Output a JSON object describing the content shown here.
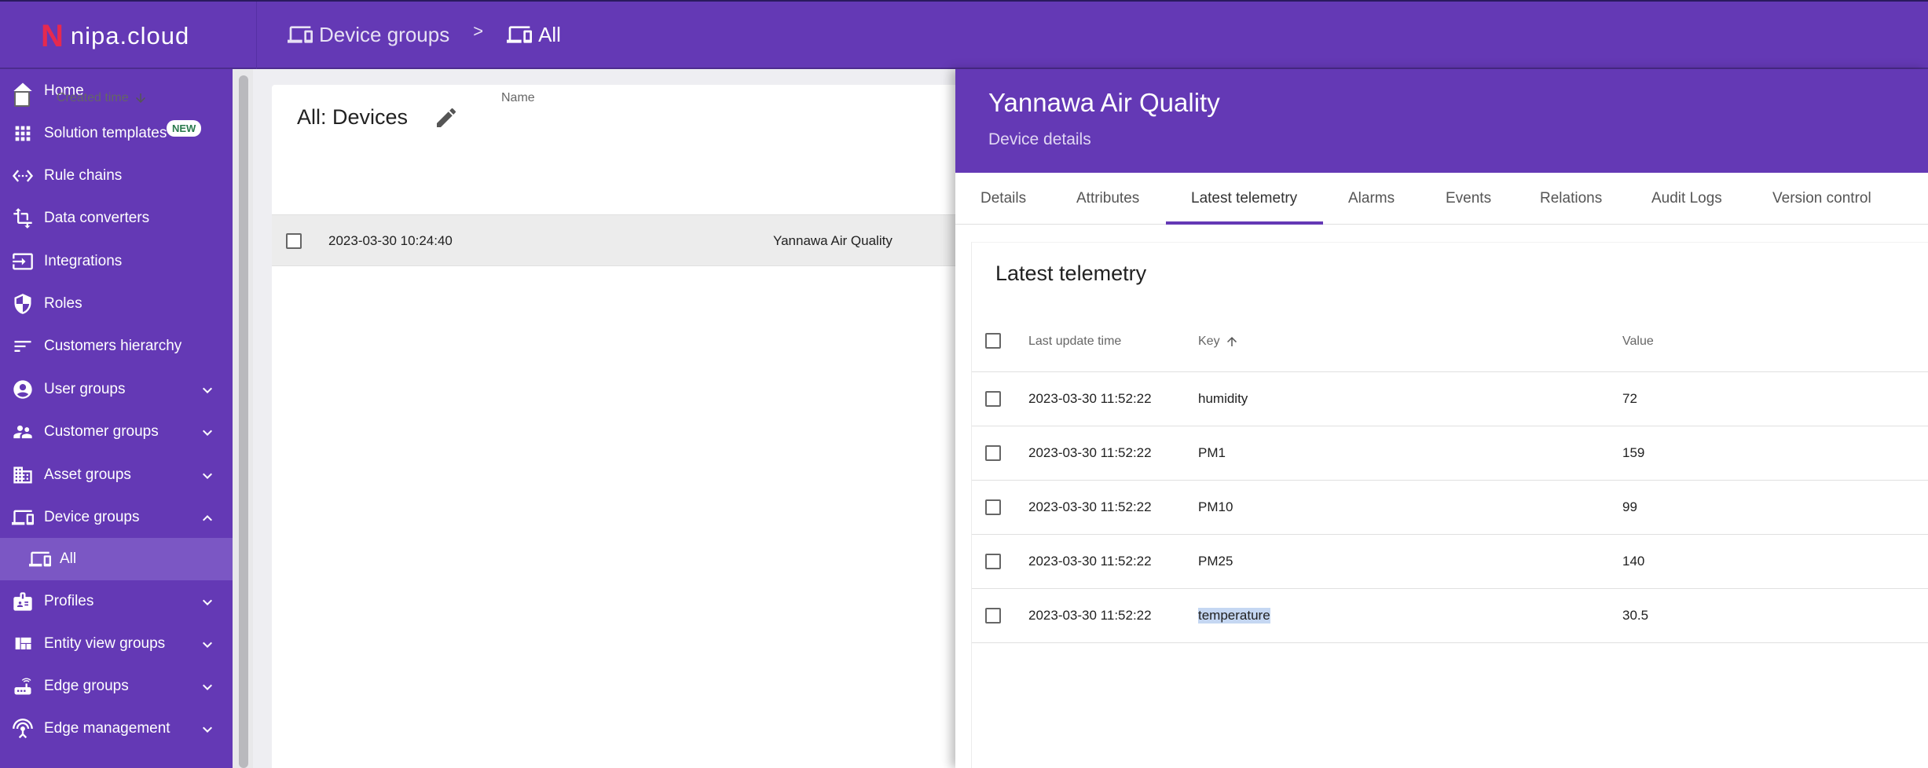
{
  "app": {
    "logo_text": "nipa.cloud",
    "logo_mark": "N"
  },
  "breadcrumb": [
    {
      "label": "Device groups",
      "icon": "devices-icon"
    },
    {
      "label": "All",
      "icon": "devices-icon"
    }
  ],
  "breadcrumb_separator": ">",
  "sidebar": {
    "items": [
      {
        "label": "Home",
        "icon": "home-icon"
      },
      {
        "label": "Solution templates",
        "icon": "apps-icon",
        "badge": "NEW"
      },
      {
        "label": "Rule chains",
        "icon": "code-icon"
      },
      {
        "label": "Data converters",
        "icon": "transform-icon"
      },
      {
        "label": "Integrations",
        "icon": "input-icon"
      },
      {
        "label": "Roles",
        "icon": "shield-icon"
      },
      {
        "label": "Customers hierarchy",
        "icon": "sort-icon"
      },
      {
        "label": "User groups",
        "icon": "account-circle-icon",
        "expandable": true
      },
      {
        "label": "Customer groups",
        "icon": "supervisor-icon",
        "expandable": true
      },
      {
        "label": "Asset groups",
        "icon": "domain-icon",
        "expandable": true
      },
      {
        "label": "Device groups",
        "icon": "devices-icon",
        "expandable": true,
        "expanded": true
      },
      {
        "label": "All",
        "icon": "devices-icon",
        "sub": true,
        "active": true
      },
      {
        "label": "Profiles",
        "icon": "badge-icon",
        "expandable": true
      },
      {
        "label": "Entity view groups",
        "icon": "view-quilt-icon",
        "expandable": true
      },
      {
        "label": "Edge groups",
        "icon": "router-icon",
        "expandable": true
      },
      {
        "label": "Edge management",
        "icon": "settings-input-antenna-icon",
        "expandable": true
      }
    ]
  },
  "main": {
    "title": "All: Devices",
    "columns": {
      "created_time": "Created time",
      "name": "Name"
    },
    "rows": [
      {
        "created_time": "2023-03-30 10:24:40",
        "name": "Yannawa Air Quality"
      }
    ]
  },
  "details": {
    "title": "Yannawa Air Quality",
    "subtitle": "Device details",
    "tabs": [
      "Details",
      "Attributes",
      "Latest telemetry",
      "Alarms",
      "Events",
      "Relations",
      "Audit Logs",
      "Version control"
    ],
    "active_tab": "Latest telemetry",
    "telemetry": {
      "title": "Latest telemetry",
      "columns": {
        "last_update_time": "Last update time",
        "key": "Key",
        "value": "Value"
      },
      "rows": [
        {
          "time": "2023-03-30 11:52:22",
          "key": "humidity",
          "value": "72"
        },
        {
          "time": "2023-03-30 11:52:22",
          "key": "PM1",
          "value": "159"
        },
        {
          "time": "2023-03-30 11:52:22",
          "key": "PM10",
          "value": "99"
        },
        {
          "time": "2023-03-30 11:52:22",
          "key": "PM25",
          "value": "140"
        },
        {
          "time": "2023-03-30 11:52:22",
          "key": "temperature",
          "value": "30.5",
          "highlighted": true
        }
      ]
    }
  },
  "colors": {
    "brand": "#6439b5",
    "accent": "#e6294f",
    "highlight": "#c5d7f2"
  }
}
